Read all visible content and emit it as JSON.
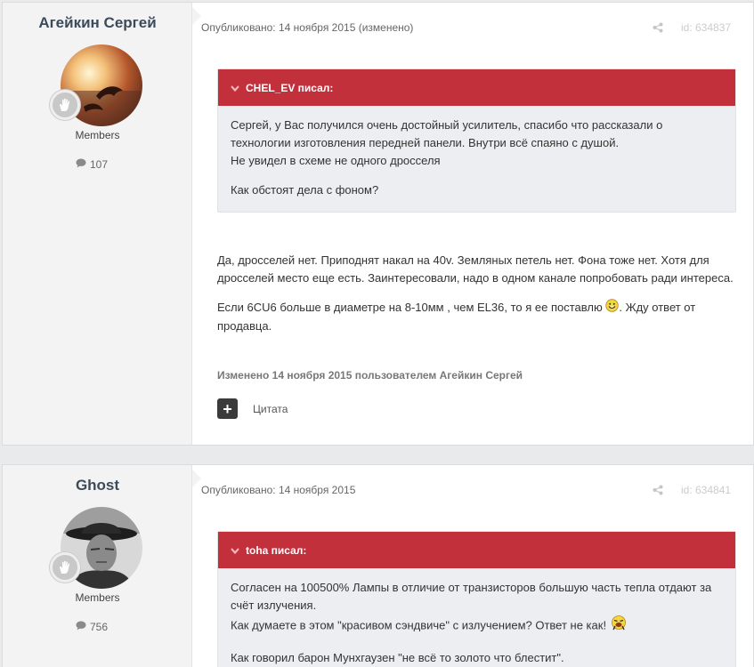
{
  "posts": [
    {
      "author": "Агейкин Сергей",
      "group": "Members",
      "post_count": "107",
      "published": "Опубликовано: 14 ноября 2015 (изменено)",
      "post_id": "id: 634837",
      "quote": {
        "header": "CHEL_EV писал:",
        "paragraphs": [
          "Сергей, у Вас получился очень достойный усилитель, спасибо что рассказали о технологии изготовления передней панели. Внутри всё спаяно с душой.",
          "Не увидел в схеме не одного дросселя",
          "Как обстоят дела с фоном?"
        ]
      },
      "body": [
        "Да, дросселей нет. Приподнят накал на 40v. Земляных петель нет. Фона тоже нет. Хотя для дросселей место еще есть. Заинтересовали, надо в одном канале попробовать ради интереса.",
        "Если 6CU6 больше в диаметре на 8-10мм , чем EL36, то я ее поставлю",
        ". Жду ответ от продавца."
      ],
      "edited_note": "Изменено 14 ноября 2015 пользователем Агейкин Сергей",
      "quote_button": "Цитата"
    },
    {
      "author": "Ghost",
      "group": "Members",
      "post_count": "756",
      "published": "Опубликовано: 14 ноября 2015",
      "post_id": "id: 634841",
      "quote": {
        "header": "toha писал:",
        "paragraphs": [
          "Согласен на 100500% Лампы в отличие от транзисторов большую часть тепла отдают за счёт излучения.",
          "Как думаете в этом \"красивом сэндвиче\" с излучением? Ответ не как!",
          "Как говорил барон Мунхгаузен \"не всё то золото что блестит\"."
        ]
      }
    }
  ],
  "colors": {
    "quote_header": "#c2303b",
    "sidebar": "#f3f3f4",
    "background": "#e9eaec"
  },
  "icons": [
    "rank-hand-icon",
    "comment-icon",
    "share-icon",
    "chevron-down-icon",
    "smile-emoji-icon",
    "laugh-emoji-icon"
  ]
}
